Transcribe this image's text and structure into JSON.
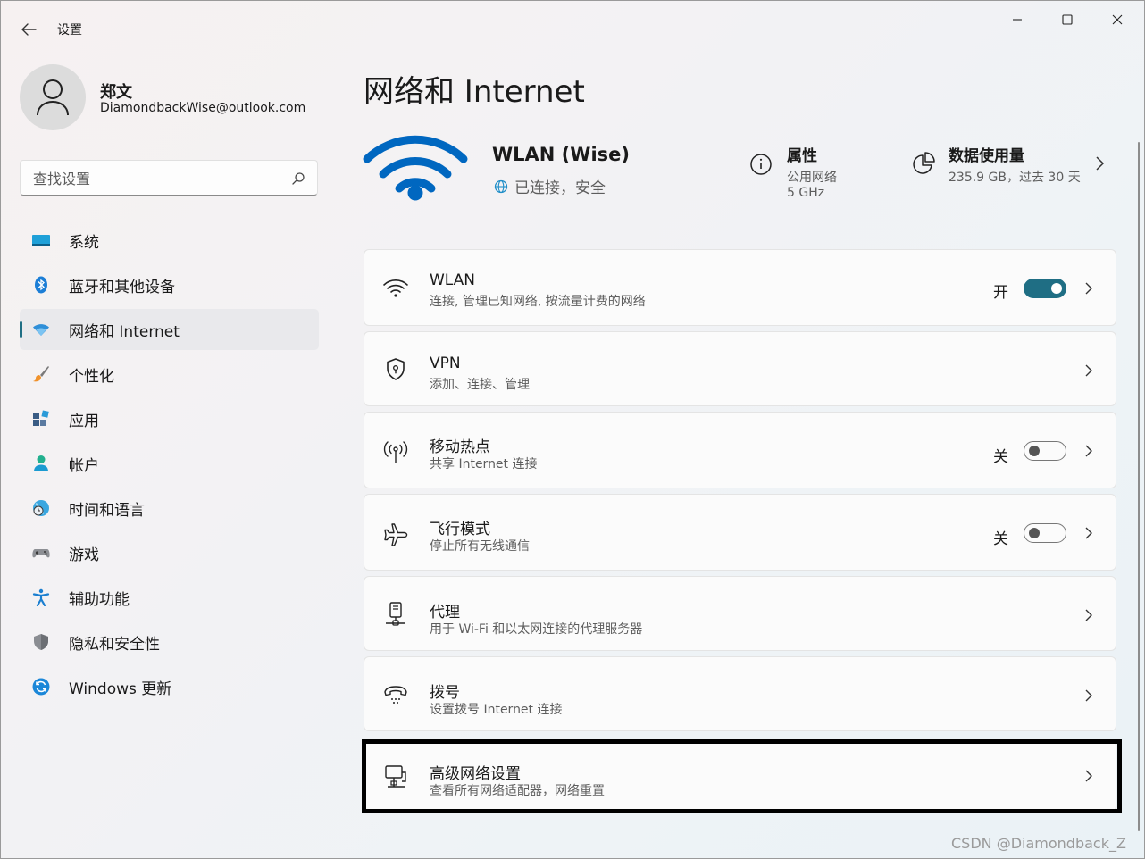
{
  "window": {
    "title": "设置"
  },
  "user": {
    "name": "郑文",
    "email": "DiamondbackWise@outlook.com"
  },
  "search": {
    "placeholder": "查找设置"
  },
  "nav": [
    {
      "label": "系统",
      "icon": "system-display-icon"
    },
    {
      "label": "蓝牙和其他设备",
      "icon": "bluetooth-icon"
    },
    {
      "label": "网络和 Internet",
      "icon": "wifi-icon",
      "active": true
    },
    {
      "label": "个性化",
      "icon": "brush-icon"
    },
    {
      "label": "应用",
      "icon": "apps-icon"
    },
    {
      "label": "帐户",
      "icon": "account-icon"
    },
    {
      "label": "时间和语言",
      "icon": "globe-clock-icon"
    },
    {
      "label": "游戏",
      "icon": "gamepad-icon"
    },
    {
      "label": "辅助功能",
      "icon": "accessibility-icon"
    },
    {
      "label": "隐私和安全性",
      "icon": "shield-icon"
    },
    {
      "label": "Windows 更新",
      "icon": "update-icon"
    }
  ],
  "main": {
    "title": "网络和 Internet",
    "network": {
      "name": "WLAN (Wise)",
      "status": "已连接，安全"
    },
    "properties": {
      "title": "属性",
      "line1": "公用网络",
      "line2": "5 GHz"
    },
    "usage": {
      "title": "数据使用量",
      "line": "235.9 GB，过去 30 天"
    },
    "cards": [
      {
        "title": "WLAN",
        "subtitle": "连接, 管理已知网络, 按流量计费的网络",
        "icon": "wifi-icon",
        "toggle_label": "开",
        "toggle_on": true
      },
      {
        "title": "VPN",
        "subtitle": "添加、连接、管理",
        "icon": "vpn-shield-icon"
      },
      {
        "title": "移动热点",
        "subtitle": "共享 Internet 连接",
        "icon": "hotspot-icon",
        "toggle_label": "关",
        "toggle_on": false
      },
      {
        "title": "飞行模式",
        "subtitle": "停止所有无线通信",
        "icon": "airplane-icon",
        "toggle_label": "关",
        "toggle_on": false
      },
      {
        "title": "代理",
        "subtitle": "用于 Wi-Fi 和以太网连接的代理服务器",
        "icon": "proxy-server-icon"
      },
      {
        "title": "拨号",
        "subtitle": "设置拨号 Internet 连接",
        "icon": "dialup-icon"
      },
      {
        "title": "高级网络设置",
        "subtitle": "查看所有网络适配器，网络重置",
        "icon": "network-adapter-icon"
      }
    ]
  },
  "watermark": "CSDN @Diamondback_Z",
  "colors": {
    "accent": "#1f6e84",
    "wifi_blue": "#0067c0",
    "highlight_border": "#000000"
  }
}
